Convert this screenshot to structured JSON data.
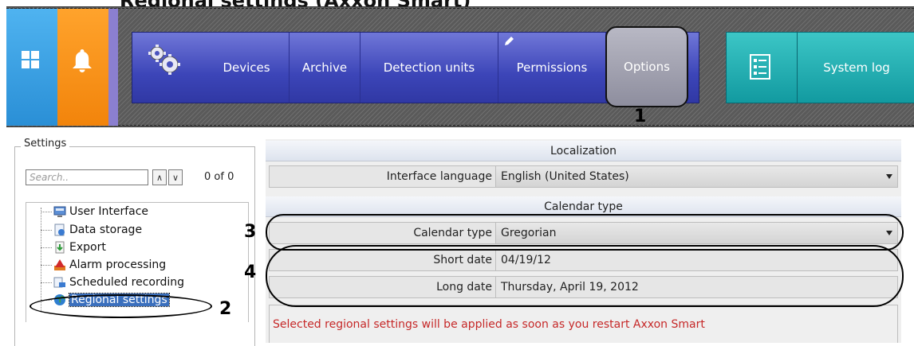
{
  "page_caption": "Regional settings (Axxon Smart)",
  "toolbar": {
    "home_tile_icon": "windows-grid-icon",
    "alarm_tile_icon": "bell-icon",
    "nav": [
      {
        "label": "Devices"
      },
      {
        "label": "Archive"
      },
      {
        "label": "Detection units"
      },
      {
        "label": "Permissions"
      },
      {
        "label": "Options"
      }
    ],
    "active_nav": "Options",
    "system_log_label": "System log"
  },
  "callouts": {
    "c1": "1",
    "c2": "2",
    "c3": "3",
    "c4": "4"
  },
  "settings_panel": {
    "title": "Settings",
    "search_placeholder": "Search..",
    "up_arrow": "∧",
    "down_arrow": "∨",
    "count": "0 of 0",
    "tree_items": [
      {
        "label": "User Interface",
        "icon": "user-interface-icon"
      },
      {
        "label": "Data storage",
        "icon": "data-storage-icon"
      },
      {
        "label": "Export",
        "icon": "export-icon"
      },
      {
        "label": "Alarm processing",
        "icon": "alarm-processing-icon"
      },
      {
        "label": "Scheduled recording",
        "icon": "scheduled-recording-icon"
      },
      {
        "label": "Regional settings",
        "icon": "globe-icon",
        "selected": true
      }
    ]
  },
  "localization": {
    "header": "Localization",
    "interface_language_label": "Interface language",
    "interface_language_value": "English (United States)"
  },
  "calendar": {
    "header": "Calendar type",
    "calendar_type_label": "Calendar type",
    "calendar_type_value": "Gregorian",
    "short_date_label": "Short date",
    "short_date_value": "04/19/12",
    "long_date_label": "Long date",
    "long_date_value": "Thursday, April 19, 2012"
  },
  "notice": "Selected regional settings will be applied as soon as you restart Axxon Smart",
  "colors": {
    "nav_blue": "#3c45b8",
    "system_log_teal": "#129aa0",
    "home_tile": "#2a8fd6",
    "alarm_tile": "#f2840b",
    "notice_red": "#c62828",
    "selection": "#3a6fbd"
  }
}
